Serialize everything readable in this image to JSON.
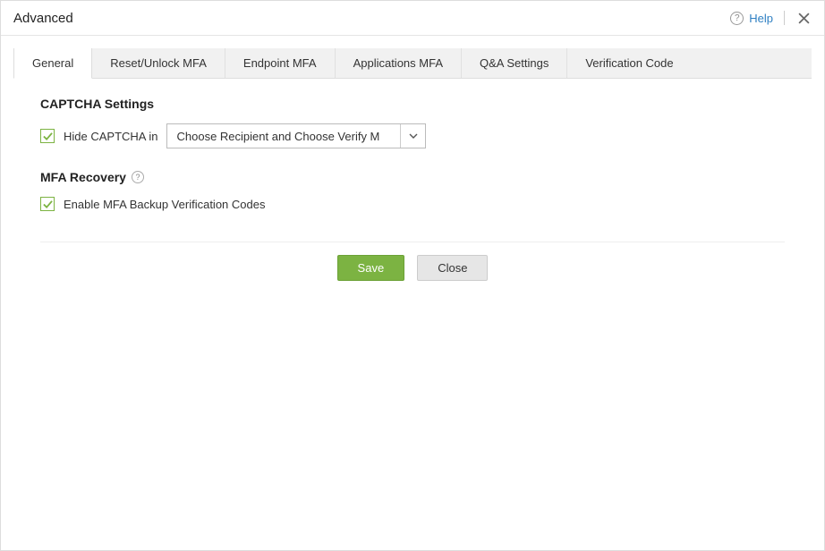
{
  "titlebar": {
    "title": "Advanced",
    "help_label": "Help"
  },
  "tabs": [
    {
      "label": "General",
      "active": true
    },
    {
      "label": "Reset/Unlock MFA",
      "active": false
    },
    {
      "label": "Endpoint MFA",
      "active": false
    },
    {
      "label": "Applications MFA",
      "active": false
    },
    {
      "label": "Q&A Settings",
      "active": false
    },
    {
      "label": "Verification Code",
      "active": false
    }
  ],
  "sections": {
    "captcha": {
      "title": "CAPTCHA Settings",
      "hide_captcha_label": "Hide CAPTCHA in",
      "hide_captcha_checked": true,
      "dropdown_value": "Choose Recipient and Choose Verify M"
    },
    "mfa_recovery": {
      "title": "MFA Recovery",
      "backup_codes_label": "Enable MFA Backup Verification Codes",
      "backup_codes_checked": true
    }
  },
  "footer": {
    "save_label": "Save",
    "close_label": "Close"
  }
}
